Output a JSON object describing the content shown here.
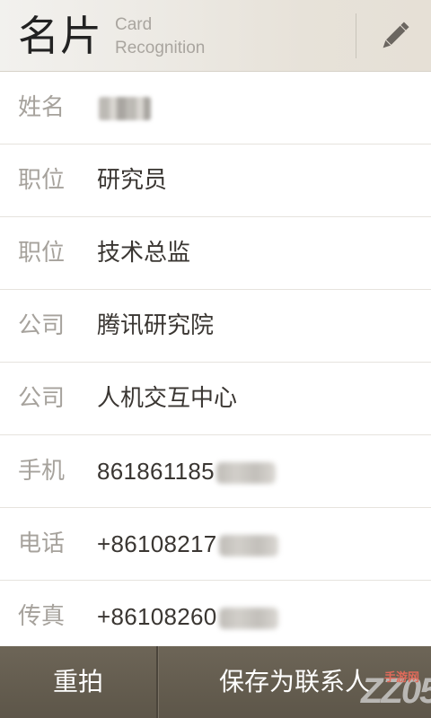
{
  "header": {
    "title": "名片",
    "subtitle_line1": "Card",
    "subtitle_line2": "Recognition",
    "edit_icon": "pencil-icon"
  },
  "fields": [
    {
      "label": "姓名",
      "value": ""
    },
    {
      "label": "职位",
      "value": "研究员"
    },
    {
      "label": "职位",
      "value": "技术总监"
    },
    {
      "label": "公司",
      "value": "腾讯研究院"
    },
    {
      "label": "公司",
      "value": "人机交互中心"
    },
    {
      "label": "手机",
      "value": "861861185"
    },
    {
      "label": "电话",
      "value": "+86108217"
    },
    {
      "label": "传真",
      "value": "+86108260"
    }
  ],
  "footer": {
    "retake_label": "重拍",
    "save_label": "保存为联系人"
  },
  "watermark": {
    "logo_text": "ZZ05",
    "caption": "手游网"
  },
  "colors": {
    "footer_bg": "#625b4e",
    "label": "#a6a29c",
    "value": "#3a3632"
  }
}
